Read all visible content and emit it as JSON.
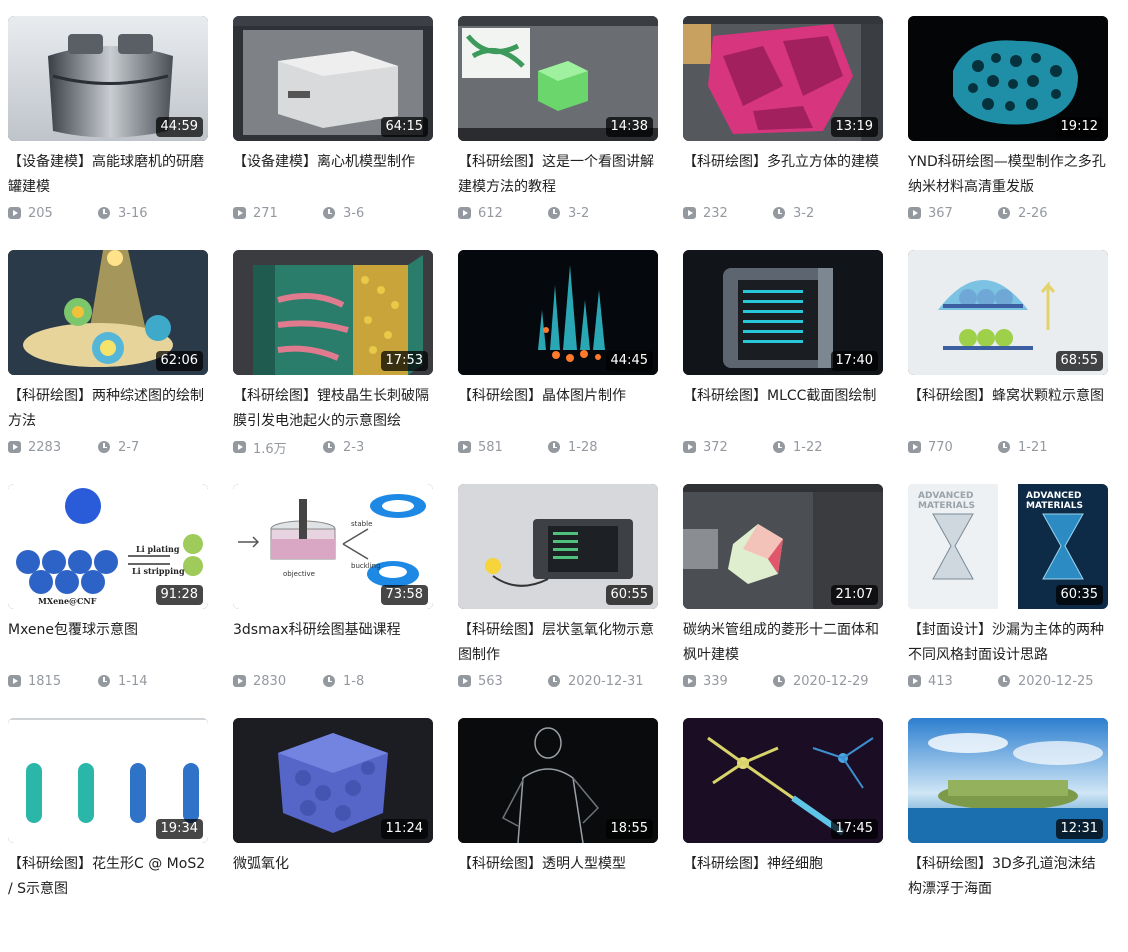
{
  "videos": [
    {
      "title": "【设备建模】高能球磨机的研磨罐建模",
      "duration": "44:59",
      "plays": "205",
      "date": "3-16",
      "thumb": "ball-mill-jar-render"
    },
    {
      "title": "【设备建模】离心机模型制作",
      "duration": "64:15",
      "plays": "271",
      "date": "3-6",
      "thumb": "centrifuge-3dsmax-viewport"
    },
    {
      "title": "【科研绘图】这是一个看图讲解建模方法的教程",
      "duration": "14:38",
      "plays": "612",
      "date": "3-2",
      "thumb": "green-block-3dsmax-viewport"
    },
    {
      "title": "【科研绘图】多孔立方体的建模",
      "duration": "13:19",
      "plays": "232",
      "date": "3-2",
      "thumb": "porous-cube-pink-viewport"
    },
    {
      "title": "YND科研绘图—模型制作之多孔纳米材料高清重发版",
      "duration": "19:12",
      "plays": "367",
      "date": "2-26",
      "thumb": "porous-nanomaterial-blue"
    },
    {
      "title": "【科研绘图】两种综述图的绘制方法",
      "duration": "62:06",
      "plays": "2283",
      "date": "2-7",
      "thumb": "review-figure-light-beam"
    },
    {
      "title": "【科研绘图】锂枝晶生长刺破隔膜引发电池起火的示意图绘",
      "duration": "17:53",
      "plays": "1.6万",
      "date": "2-3",
      "thumb": "lithium-dendrite-battery"
    },
    {
      "title": "【科研绘图】晶体图片制作",
      "duration": "44:45",
      "plays": "581",
      "date": "1-28",
      "thumb": "glowing-crystals"
    },
    {
      "title": "【科研绘图】MLCC截面图绘制",
      "duration": "17:40",
      "plays": "372",
      "date": "1-22",
      "thumb": "mlcc-cross-section"
    },
    {
      "title": "【科研绘图】蜂窝状颗粒示意图",
      "duration": "68:55",
      "plays": "770",
      "date": "1-21",
      "thumb": "honeycomb-particles"
    },
    {
      "title": "Mxene包覆球示意图",
      "duration": "91:28",
      "plays": "1815",
      "date": "1-14",
      "thumb": "mxene-coated-spheres",
      "thumb_labels": [
        "Li plating",
        "Li stripping",
        "MXene@CNF"
      ]
    },
    {
      "title": "3dsmax科研绘图基础课程",
      "duration": "73:58",
      "plays": "2830",
      "date": "1-8",
      "thumb": "beaker-objective-rings",
      "thumb_labels": [
        "stable",
        "buckling",
        "objective"
      ]
    },
    {
      "title": "【科研绘图】层状氢氧化物示意图制作",
      "duration": "60:55",
      "plays": "563",
      "date": "2020-12-31",
      "thumb": "layered-hydroxide-device"
    },
    {
      "title": "碳纳米管组成的菱形十二面体和枫叶建模",
      "duration": "21:07",
      "plays": "339",
      "date": "2020-12-29",
      "thumb": "dodecahedron-viewport"
    },
    {
      "title": "【封面设计】沙漏为主体的两种不同风格封面设计思路",
      "duration": "60:35",
      "plays": "413",
      "date": "2020-12-25",
      "thumb": "hourglass-covers",
      "thumb_labels": [
        "ADVANCED",
        "MATERIALS"
      ]
    },
    {
      "title": "【科研绘图】花生形C @ MoS2 / S示意图",
      "duration": "19:34",
      "plays": "",
      "date": "",
      "thumb": "peanut-shaped-capsules"
    },
    {
      "title": "微弧氧化",
      "duration": "11:24",
      "plays": "",
      "date": "",
      "thumb": "blue-sphere-cube"
    },
    {
      "title": "【科研绘图】透明人型模型",
      "duration": "18:55",
      "plays": "",
      "date": "",
      "thumb": "transparent-human"
    },
    {
      "title": "【科研绘图】神经细胞",
      "duration": "17:45",
      "plays": "",
      "date": "",
      "thumb": "neuron-cells"
    },
    {
      "title": "【科研绘图】3D多孔道泡沫结构漂浮于海面",
      "duration": "12:31",
      "plays": "",
      "date": "",
      "thumb": "porous-foam-on-sea"
    }
  ],
  "colors": {
    "text": "#212121",
    "meta": "#9499a0",
    "badge_bg": "rgba(0,0,0,0.72)"
  }
}
